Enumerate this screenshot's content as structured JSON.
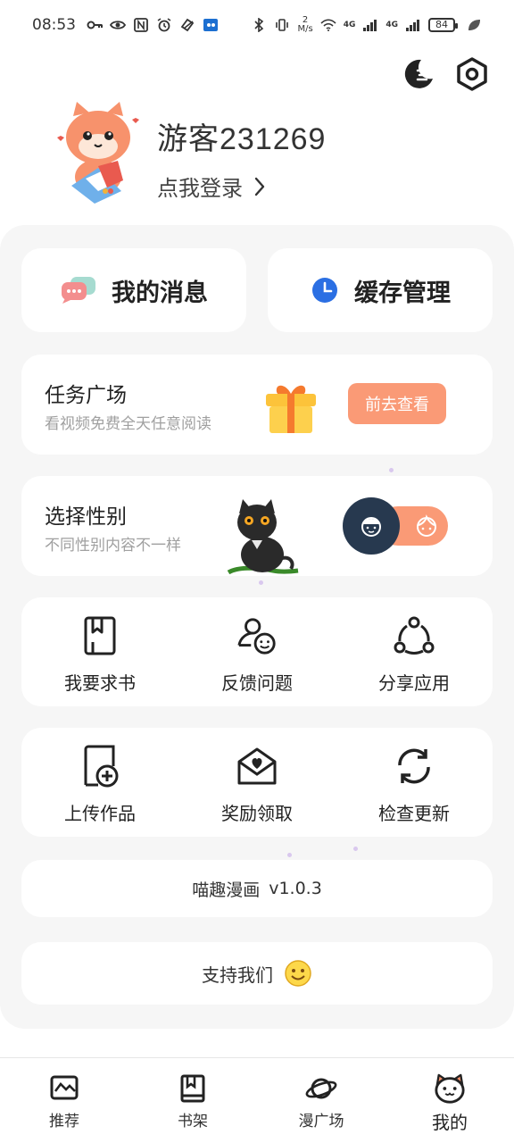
{
  "status_bar": {
    "time": "08:53",
    "speed_top": "2",
    "speed_unit": "M/s",
    "network1": "4G",
    "network2": "4G",
    "battery": "84"
  },
  "top_icons": [
    "theme-moon-icon",
    "settings-icon"
  ],
  "profile": {
    "username": "游客231269",
    "login_label": "点我登录"
  },
  "quick": {
    "messages_label": "我的消息",
    "cache_label": "缓存管理"
  },
  "task": {
    "title": "任务广场",
    "subtitle": "看视频免费全天任意阅读",
    "button_label": "前去查看"
  },
  "gender": {
    "title": "选择性别",
    "subtitle": "不同性别内容不一样"
  },
  "grid1": [
    {
      "label": "我要求书",
      "icon": "book-request-icon"
    },
    {
      "label": "反馈问题",
      "icon": "feedback-icon"
    },
    {
      "label": "分享应用",
      "icon": "share-icon"
    }
  ],
  "grid2": [
    {
      "label": "上传作品",
      "icon": "upload-icon"
    },
    {
      "label": "奖励领取",
      "icon": "reward-envelope-icon"
    },
    {
      "label": "检查更新",
      "icon": "refresh-icon"
    }
  ],
  "version": {
    "app_name": "喵趣漫画",
    "version": "v1.0.3"
  },
  "support": {
    "label": "支持我们"
  },
  "bottom_nav": [
    {
      "label": "推荐",
      "icon": "recommend-icon"
    },
    {
      "label": "书架",
      "icon": "bookshelf-icon"
    },
    {
      "label": "漫广场",
      "icon": "planet-icon"
    },
    {
      "label": "我的",
      "icon": "cat-face-icon",
      "active": true
    }
  ],
  "colors": {
    "accent": "#fa9a76",
    "toggle_dark": "#27394f",
    "panel_bg": "#f6f6f6"
  }
}
